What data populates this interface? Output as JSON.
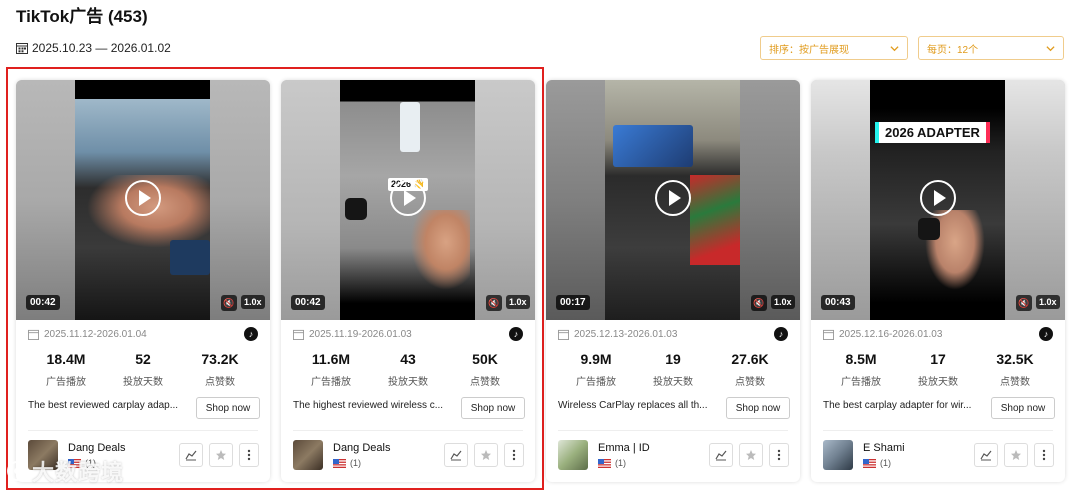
{
  "page": {
    "title": "TikTok广告 (453)",
    "date_range": "2025.10.23 — 2026.01.02"
  },
  "filters": {
    "sort_label": "排序：按广告展现",
    "per_page_label": "每页：12个"
  },
  "labels": {
    "impressions": "广告播放",
    "days": "投放天数",
    "likes": "点赞数",
    "shop_now": "Shop now"
  },
  "cards": [
    {
      "duration": "00:42",
      "speed": "1.0x",
      "date_range": "2025.11.12-2026.01.04",
      "impressions": "18.4M",
      "days": "52",
      "likes": "73.2K",
      "description": "The best reviewed carplay adap...",
      "author": "Dang Deals",
      "country_count": "(1)"
    },
    {
      "duration": "00:42",
      "speed": "1.0x",
      "date_range": "2025.11.19-2026.01.03",
      "impressions": "11.6M",
      "days": "43",
      "likes": "50K",
      "description": "The highest reviewed wireless c...",
      "author": "Dang Deals",
      "country_count": "(1)",
      "overlay_text": "2026 👋"
    },
    {
      "duration": "00:17",
      "speed": "1.0x",
      "date_range": "2025.12.13-2026.01.03",
      "impressions": "9.9M",
      "days": "19",
      "likes": "27.6K",
      "description": "Wireless CarPlay replaces all th...",
      "author": "Emma | ID",
      "country_count": "(1)"
    },
    {
      "duration": "00:43",
      "speed": "1.0x",
      "date_range": "2025.12.16-2026.01.03",
      "impressions": "8.5M",
      "days": "17",
      "likes": "32.5K",
      "description": "The best carplay adapter for wir...",
      "author": "E Shami",
      "country_count": "(1)",
      "overlay_text": "2026 ADAPTER"
    }
  ],
  "watermark": "大数跨境",
  "colors": {
    "accent": "#e09b1c",
    "highlight": "#e0201e"
  }
}
